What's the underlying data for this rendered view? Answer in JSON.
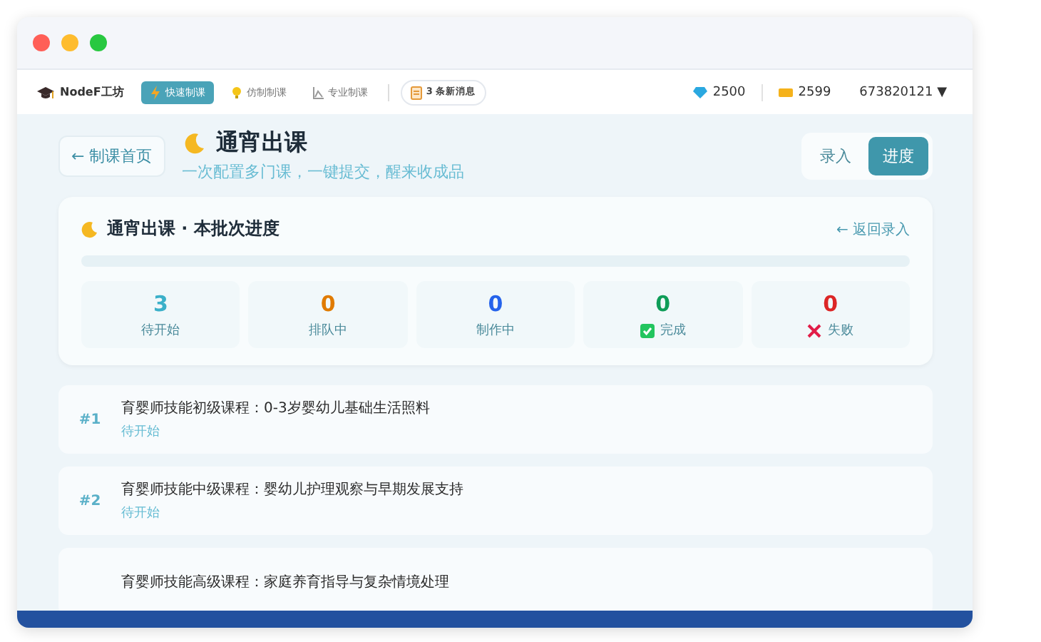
{
  "navbar": {
    "brand": "NodeF工坊",
    "nav_items": [
      {
        "label": "快速制课",
        "selected": true
      },
      {
        "label": "仿制制课",
        "selected": false
      },
      {
        "label": "专业制课",
        "selected": false
      }
    ],
    "messages": "3 条新消息",
    "gems": "2500",
    "coins": "2599",
    "account": "673820121",
    "account_caret": "▼"
  },
  "header": {
    "back": "← 制课首页",
    "title": "通宵出课",
    "subtitle": "一次配置多门课，一键提交，醒来收成品",
    "mode_tabs": [
      {
        "label": "录入",
        "selected": false
      },
      {
        "label": "进度",
        "selected": true
      }
    ]
  },
  "progress_card": {
    "title": "通宵出课 · 本批次进度",
    "back_link": "← 返回录入",
    "stats": [
      {
        "count": "3",
        "label": "待开始",
        "color": "#3bb0c9",
        "kind": "plain"
      },
      {
        "count": "0",
        "label": "排队中",
        "color": "#e07b00",
        "kind": "plain"
      },
      {
        "count": "0",
        "label": "制作中",
        "color": "#2563eb",
        "kind": "plain"
      },
      {
        "count": "0",
        "label": "完成",
        "color": "#0f9d58",
        "kind": "done"
      },
      {
        "count": "0",
        "label": "失败",
        "color": "#dc2626",
        "kind": "failed"
      }
    ]
  },
  "jobs": [
    {
      "index": "#1",
      "title": "育婴师技能初级课程：0-3岁婴幼儿基础生活照料",
      "status": "待开始"
    },
    {
      "index": "#2",
      "title": "育婴师技能中级课程：婴幼儿护理观察与早期发展支持",
      "status": "待开始"
    },
    {
      "title": "育婴师技能高级课程：家庭养育指导与复杂情境处理"
    }
  ]
}
